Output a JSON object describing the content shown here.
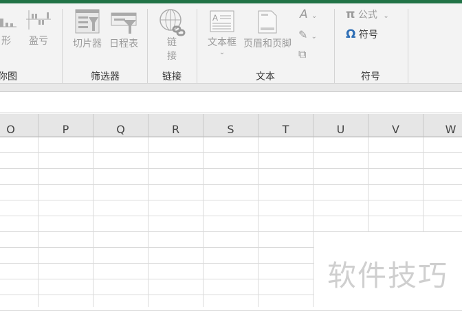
{
  "ribbon": {
    "sparkline_group": {
      "label": "迷你图",
      "partial_label": "你图",
      "buttons": [
        "柱形",
        "盈亏"
      ],
      "partial_first": "形"
    },
    "filter_group": {
      "label": "筛选器",
      "buttons": [
        "切片器",
        "日程表"
      ]
    },
    "link_group": {
      "label": "链接",
      "button_line1": "链",
      "button_line2": "接"
    },
    "text_group": {
      "label": "文本",
      "buttons": [
        "文本框",
        "页眉和页脚"
      ]
    },
    "symbol_group": {
      "label": "符号",
      "equation": "公式",
      "symbol": "符号"
    }
  },
  "columns": [
    "O",
    "P",
    "Q",
    "R",
    "S",
    "T",
    "U",
    "V",
    "W"
  ],
  "watermark": "软件技巧",
  "colors": {
    "accent": "#217346",
    "symbol_blue": "#2e6eb5"
  }
}
